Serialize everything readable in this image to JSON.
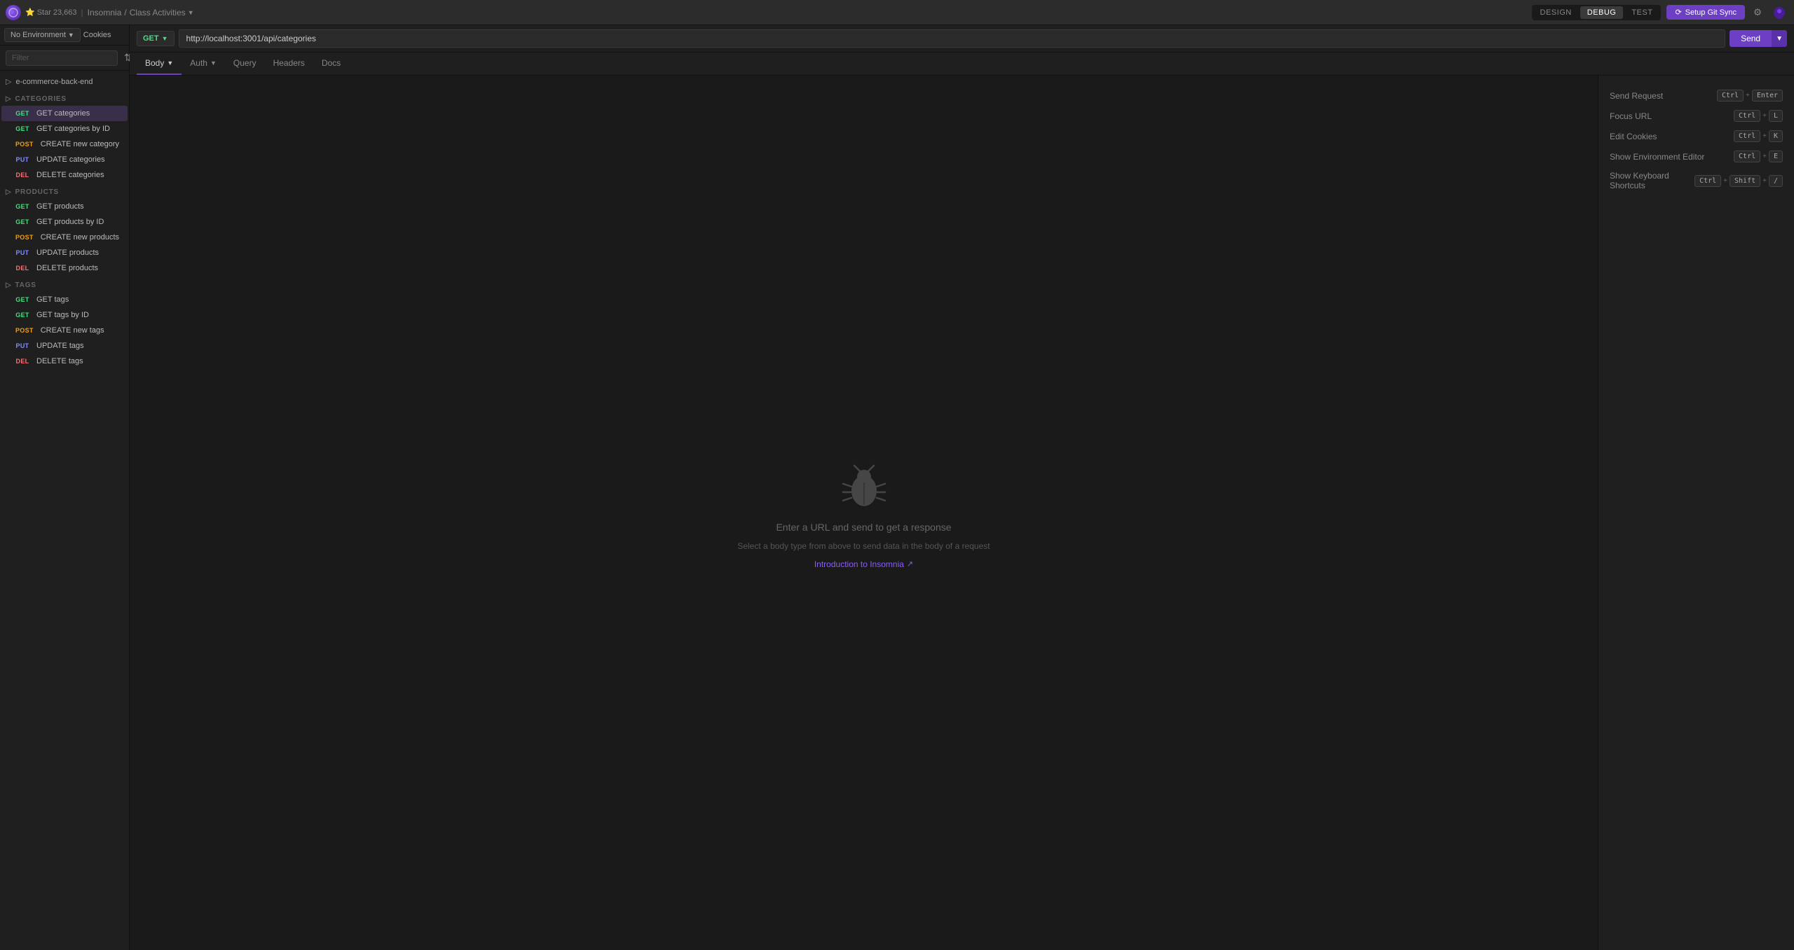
{
  "app": {
    "logo_char": "🌙",
    "star_label": "Star",
    "star_count": "23,663",
    "breadcrumb_root": "Insomnia",
    "breadcrumb_separator": "/",
    "breadcrumb_current": "Class Activities",
    "mode_tabs": [
      "DESIGN",
      "DEBUG",
      "TEST"
    ],
    "active_mode": "DEBUG",
    "git_sync_label": "Setup Git Sync",
    "settings_icon": "⚙",
    "profile_icon": "👤"
  },
  "sidebar": {
    "filter_placeholder": "Filter",
    "collection_label": "e-commerce-back-end",
    "sections": [
      {
        "name": "CATEGORIES",
        "items": [
          {
            "method": "GET",
            "label": "GET categories",
            "active": true
          },
          {
            "method": "GET",
            "label": "GET categories by ID"
          },
          {
            "method": "POST",
            "label": "CREATE new category"
          },
          {
            "method": "PUT",
            "label": "UPDATE categories"
          },
          {
            "method": "DEL",
            "label": "DELETE categories"
          }
        ]
      },
      {
        "name": "PRODUCTS",
        "items": [
          {
            "method": "GET",
            "label": "GET products"
          },
          {
            "method": "GET",
            "label": "GET products by ID"
          },
          {
            "method": "POST",
            "label": "CREATE new products"
          },
          {
            "method": "PUT",
            "label": "UPDATE products"
          },
          {
            "method": "DEL",
            "label": "DELETE products"
          }
        ]
      },
      {
        "name": "TAGS",
        "items": [
          {
            "method": "GET",
            "label": "GET tags"
          },
          {
            "method": "GET",
            "label": "GET tags by ID"
          },
          {
            "method": "POST",
            "label": "CREATE new tags"
          },
          {
            "method": "PUT",
            "label": "UPDATE tags"
          },
          {
            "method": "DEL",
            "label": "DELETE tags"
          }
        ]
      }
    ]
  },
  "url_bar": {
    "method": "GET",
    "url": "http://localhost:3001/api/categories",
    "send_label": "Send"
  },
  "request_tabs": [
    {
      "label": "Body",
      "has_dropdown": true,
      "active": true
    },
    {
      "label": "Auth",
      "has_dropdown": true
    },
    {
      "label": "Query"
    },
    {
      "label": "Headers"
    },
    {
      "label": "Docs"
    }
  ],
  "empty_state": {
    "title": "Enter a URL and send to get a response",
    "subtitle": "Select a body type from above to send data in the body of a request",
    "intro_link": "Introduction to Insomnia"
  },
  "shortcuts": [
    {
      "label": "Send Request",
      "keys": [
        "Ctrl",
        "+",
        "Enter"
      ]
    },
    {
      "label": "Focus URL",
      "keys": [
        "Ctrl",
        "+",
        "L"
      ]
    },
    {
      "label": "Edit Cookies",
      "keys": [
        "Ctrl",
        "+",
        "K"
      ]
    },
    {
      "label": "Show Environment Editor",
      "keys": [
        "Ctrl",
        "+",
        "E"
      ]
    },
    {
      "label": "Show Keyboard Shortcuts",
      "keys": [
        "Ctrl",
        "+",
        "Shift",
        "+",
        "/"
      ]
    }
  ],
  "environment": {
    "label": "No Environment"
  },
  "cookies_label": "Cookies"
}
